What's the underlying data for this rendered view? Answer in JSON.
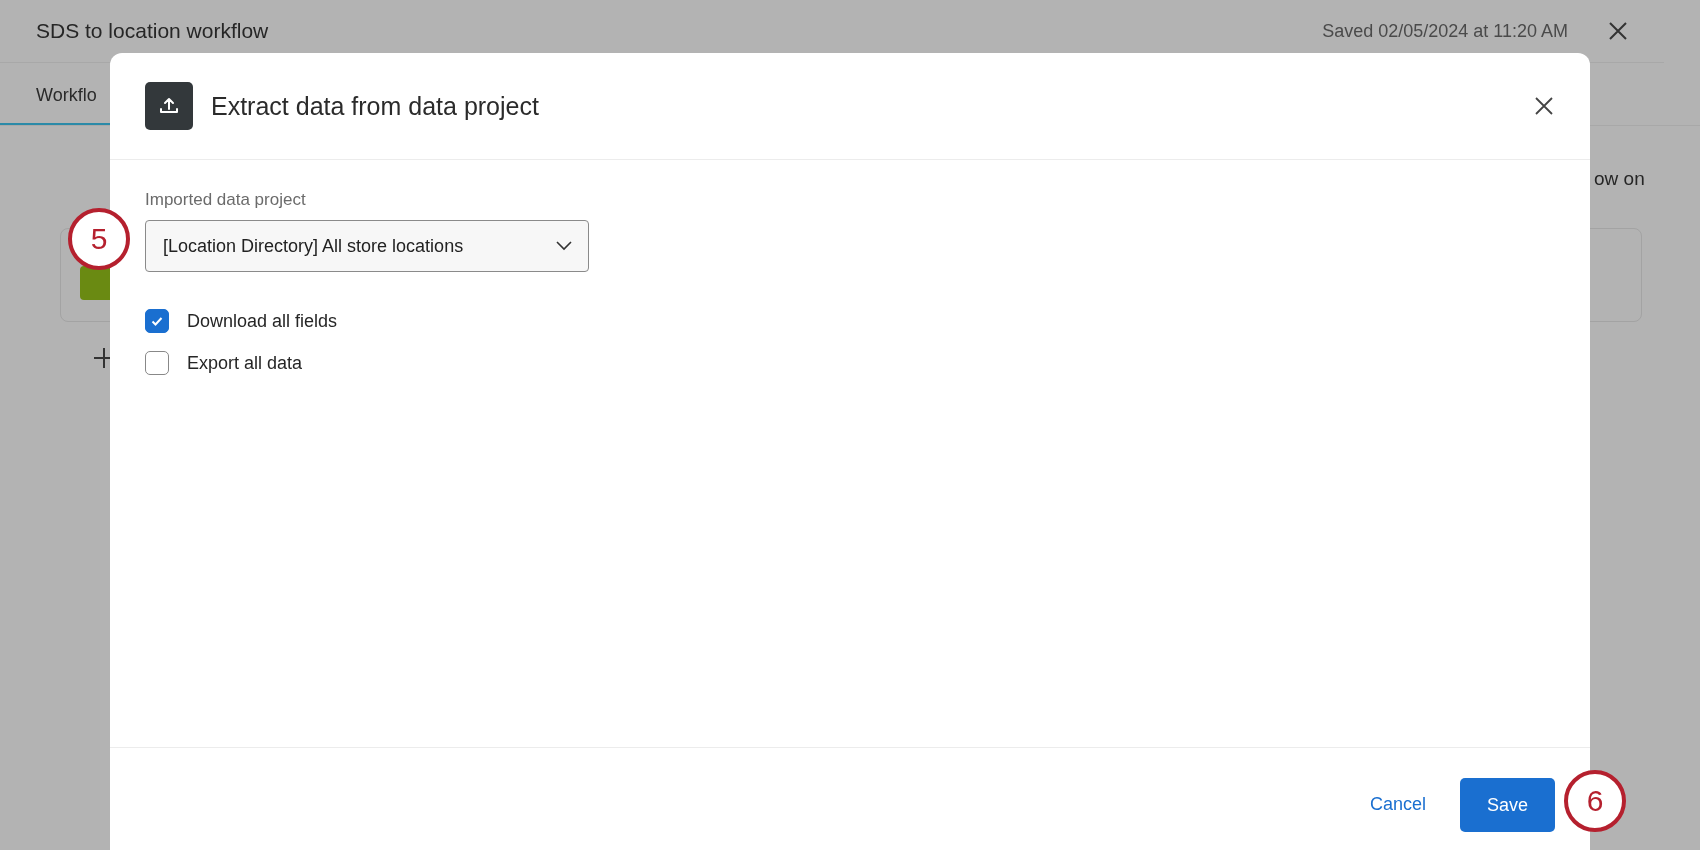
{
  "page": {
    "title": "SDS to location workflow",
    "saved": "Saved 02/05/2024 at 11:20 AM",
    "tab": {
      "label": "Workflo",
      "selected": true
    },
    "side_text": "ow on"
  },
  "dialog": {
    "title": "Extract data from data project",
    "field": {
      "label": "Imported data project",
      "value": "[Location Directory] All store locations"
    },
    "options": [
      {
        "label": "Download all fields",
        "checked": true
      },
      {
        "label": "Export all data",
        "checked": false
      }
    ],
    "buttons": [
      {
        "label": "Cancel",
        "kind": "link"
      },
      {
        "label": "Save",
        "kind": "primary"
      }
    ]
  },
  "callouts": [
    {
      "label": "5",
      "kind": "field"
    },
    {
      "label": "6",
      "kind": "save"
    }
  ]
}
